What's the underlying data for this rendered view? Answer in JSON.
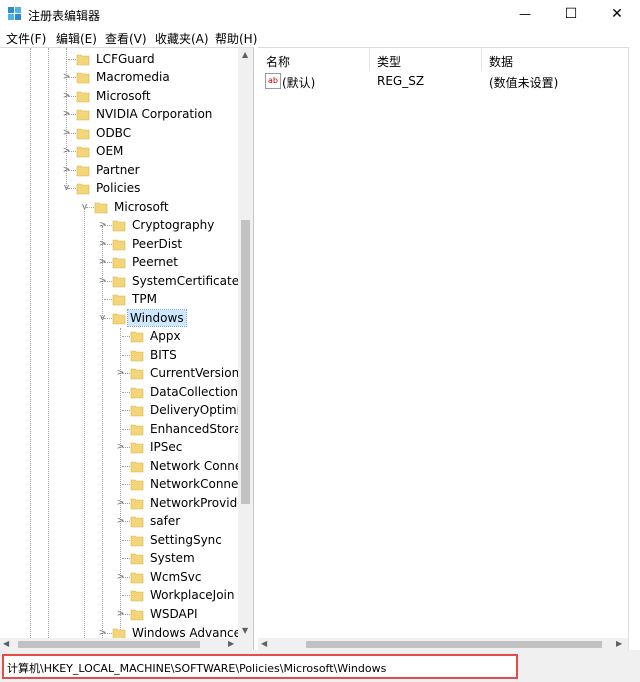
{
  "window": {
    "title": "注册表编辑器",
    "controls": {
      "minimize": "—",
      "maximize": "☐",
      "close": "✕"
    }
  },
  "menu": [
    "文件(F)",
    "编辑(E)",
    "查看(V)",
    "收藏夹(A)",
    "帮助(H)"
  ],
  "tree": [
    {
      "label": "LCFGuard",
      "expander": ""
    },
    {
      "label": "Macromedia",
      "expander": ">"
    },
    {
      "label": "Microsoft",
      "expander": ">"
    },
    {
      "label": "NVIDIA Corporation",
      "expander": ">"
    },
    {
      "label": "ODBC",
      "expander": ">"
    },
    {
      "label": "OEM",
      "expander": ">"
    },
    {
      "label": "Partner",
      "expander": ">"
    },
    {
      "label": "Policies",
      "expander": "v"
    },
    {
      "label": "Microsoft",
      "expander": "v"
    },
    {
      "label": "Cryptography",
      "expander": ">"
    },
    {
      "label": "PeerDist",
      "expander": ">"
    },
    {
      "label": "Peernet",
      "expander": ">"
    },
    {
      "label": "SystemCertificates",
      "expander": ">"
    },
    {
      "label": "TPM",
      "expander": ""
    },
    {
      "label": "Windows",
      "expander": "v",
      "selected": true
    },
    {
      "label": "Appx",
      "expander": ""
    },
    {
      "label": "BITS",
      "expander": ""
    },
    {
      "label": "CurrentVersion",
      "expander": ">"
    },
    {
      "label": "DataCollection",
      "expander": ""
    },
    {
      "label": "DeliveryOptimiza",
      "expander": ""
    },
    {
      "label": "EnhancedStorag",
      "expander": ""
    },
    {
      "label": "IPSec",
      "expander": ">"
    },
    {
      "label": "Network Connec",
      "expander": ""
    },
    {
      "label": "NetworkConnect",
      "expander": ""
    },
    {
      "label": "NetworkProvider",
      "expander": ">"
    },
    {
      "label": "safer",
      "expander": ">"
    },
    {
      "label": "SettingSync",
      "expander": ""
    },
    {
      "label": "System",
      "expander": ""
    },
    {
      "label": "WcmSvc",
      "expander": ">"
    },
    {
      "label": "WorkplaceJoin",
      "expander": ""
    },
    {
      "label": "WSDAPI",
      "expander": ">"
    },
    {
      "label": "Windows Advanced",
      "expander": ">"
    }
  ],
  "columns": {
    "name": "名称",
    "type": "类型",
    "data": "数据"
  },
  "values": [
    {
      "icon": "ab",
      "name": "(默认)",
      "type": "REG_SZ",
      "data": "(数值未设置)"
    }
  ],
  "status": {
    "path": "计算机\\HKEY_LOCAL_MACHINE\\SOFTWARE\\Policies\\Microsoft\\Windows"
  },
  "colors": {
    "selection": "#cce8ff",
    "folder": "#f3d67a",
    "highlight_box": "#e64b4b"
  }
}
